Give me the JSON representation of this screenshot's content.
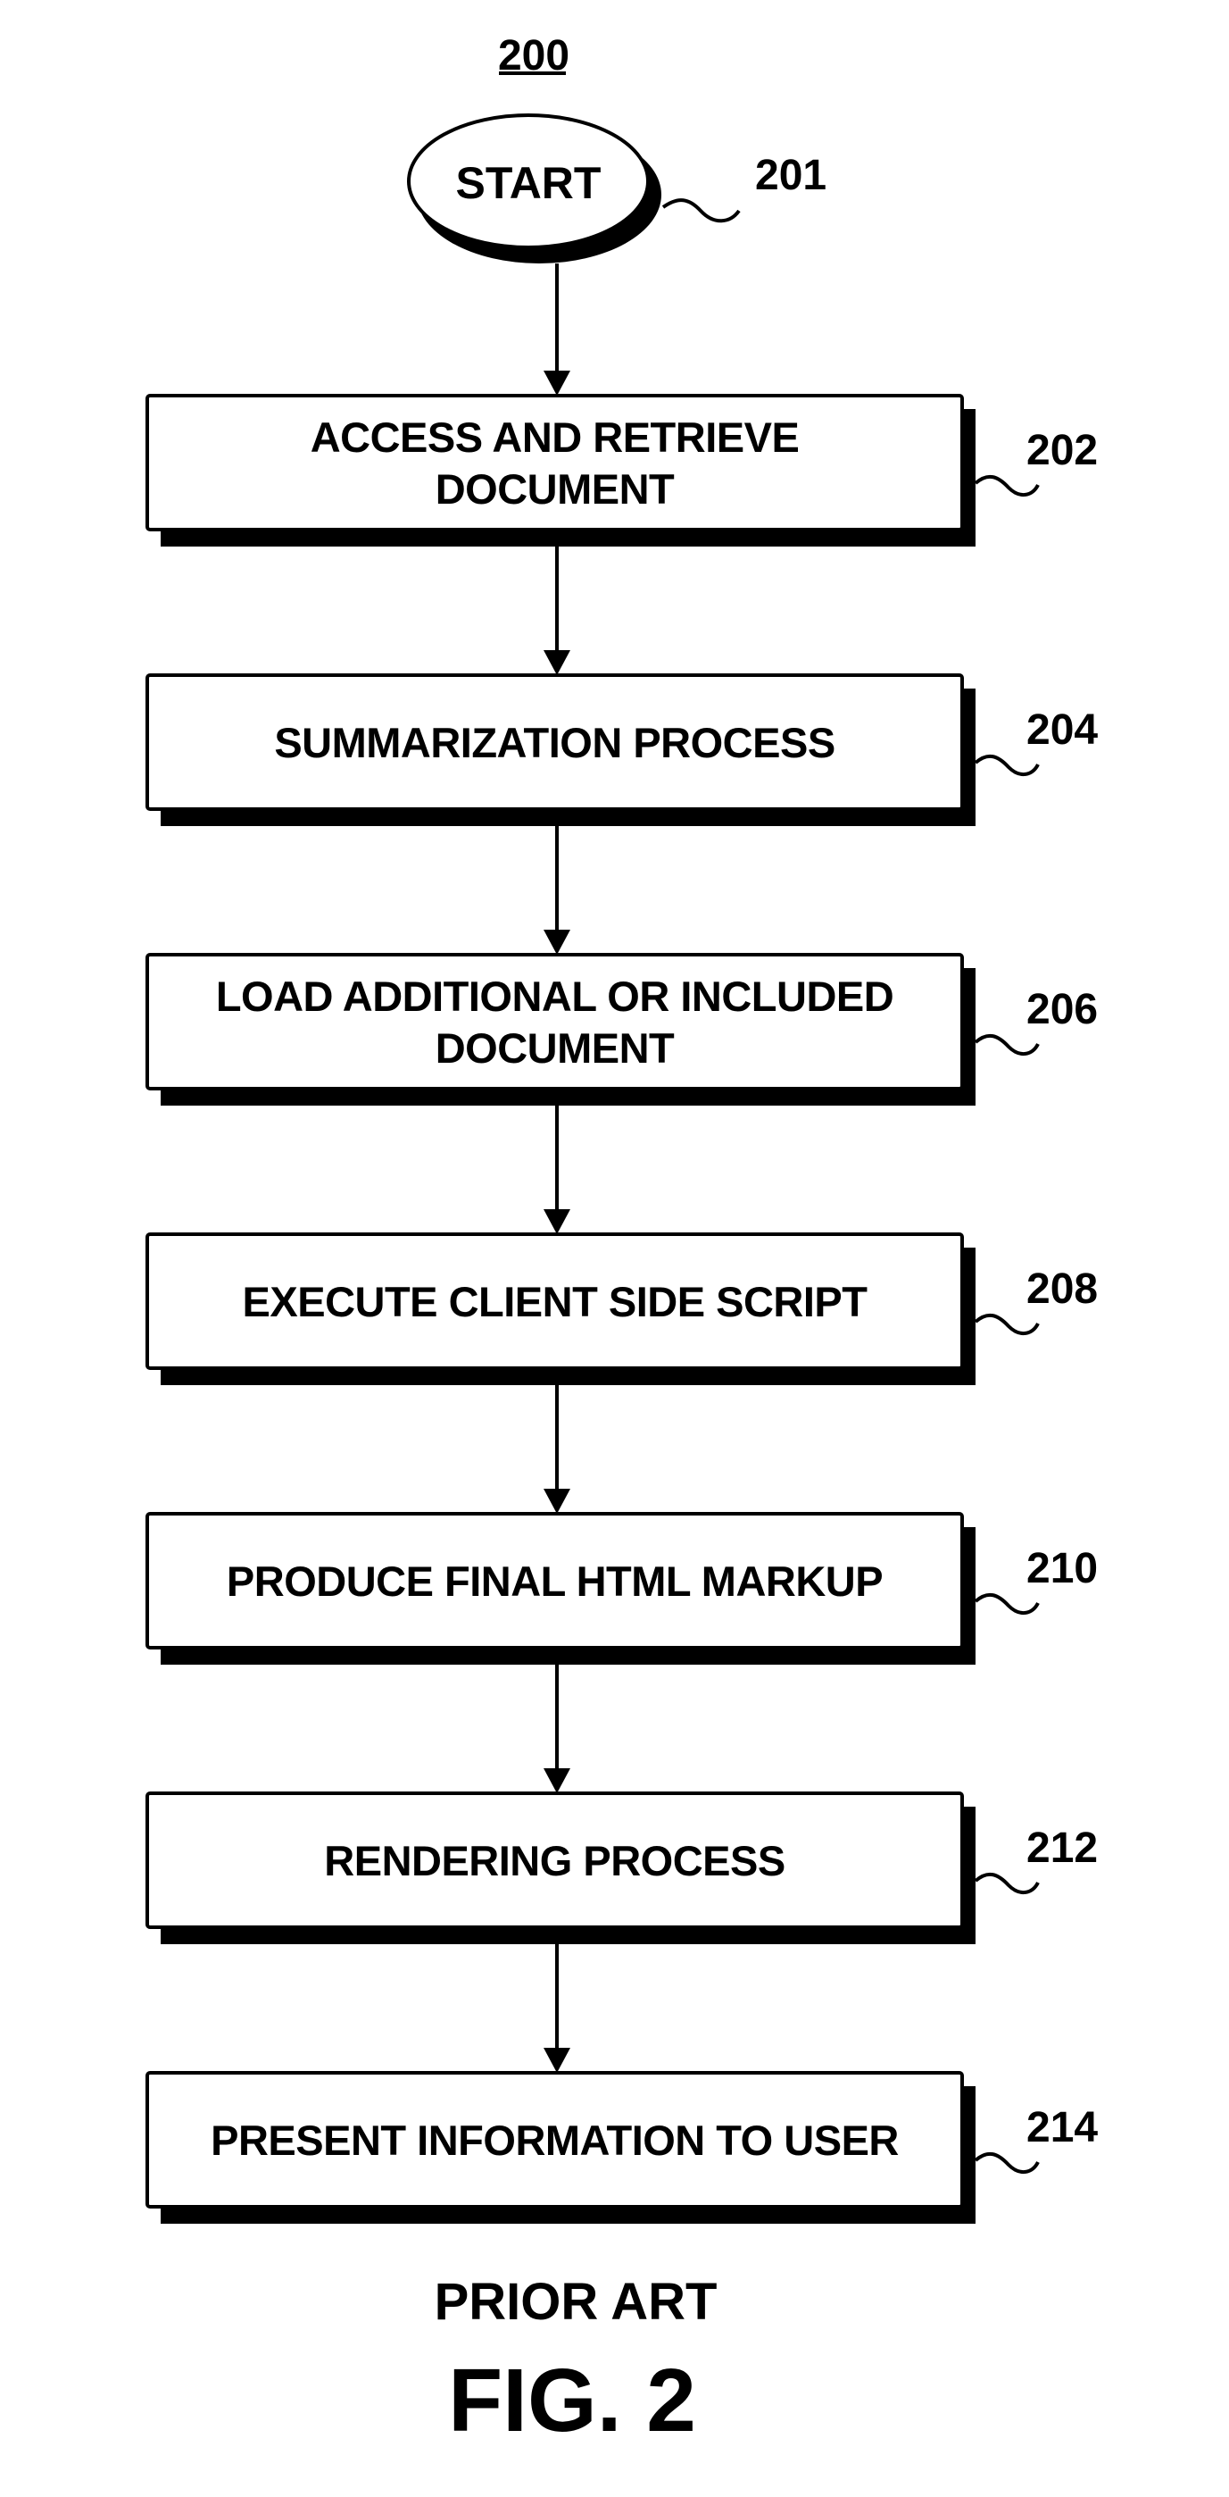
{
  "figure": {
    "reference_number": "200",
    "caption_note": "PRIOR ART",
    "caption": "FIG. 2"
  },
  "start": {
    "label": "START",
    "ref": "201"
  },
  "steps": [
    {
      "ref": "202",
      "lines": [
        "ACCESS AND RETRIEVE",
        "DOCUMENT"
      ]
    },
    {
      "ref": "204",
      "lines": [
        "SUMMARIZATION PROCESS"
      ]
    },
    {
      "ref": "206",
      "lines": [
        "LOAD ADDITIONAL OR INCLUDED",
        "DOCUMENT"
      ]
    },
    {
      "ref": "208",
      "lines": [
        "EXECUTE CLIENT SIDE SCRIPT"
      ]
    },
    {
      "ref": "210",
      "lines": [
        "PRODUCE FINAL HTML MARKUP"
      ]
    },
    {
      "ref": "212",
      "lines": [
        "RENDERING PROCESS"
      ]
    },
    {
      "ref": "214",
      "lines": [
        "PRESENT INFORMATION TO USER"
      ]
    }
  ],
  "colors": {
    "ink": "#000000",
    "paper": "#ffffff"
  }
}
